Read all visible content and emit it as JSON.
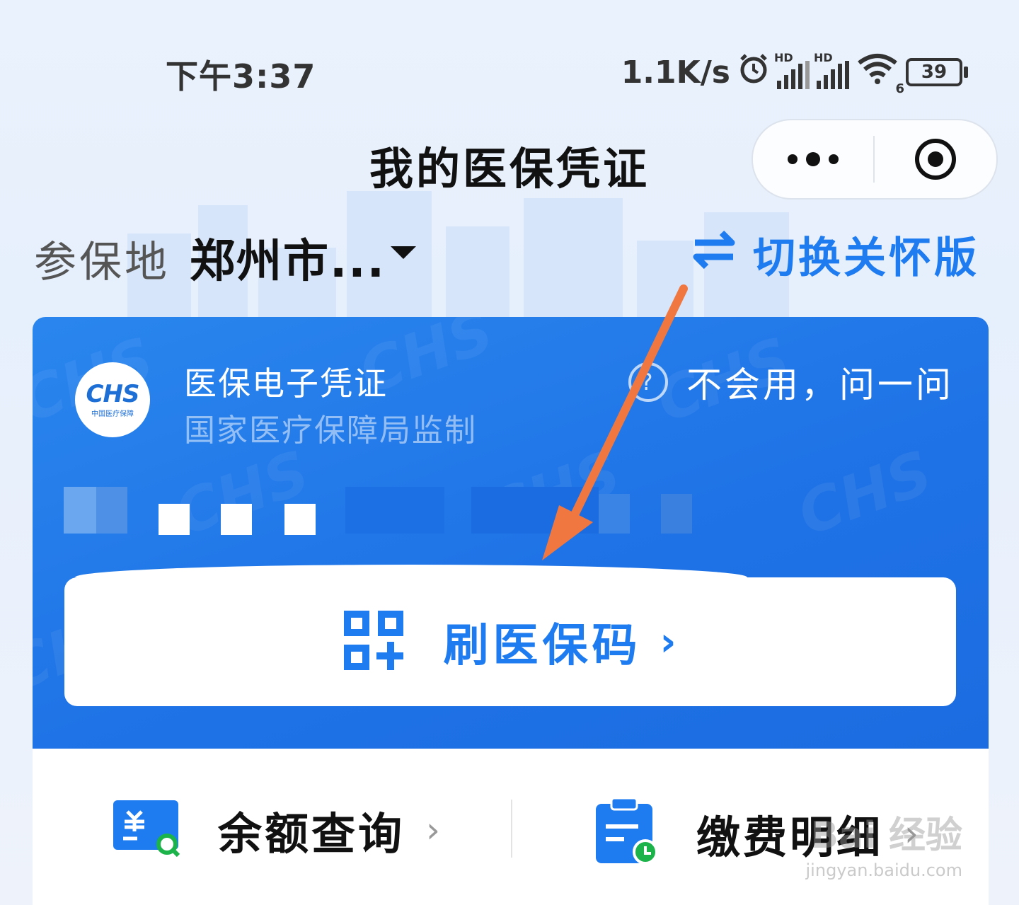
{
  "status_bar": {
    "time": "下午3:37",
    "net_speed": "1.1K/s",
    "battery": "39",
    "wifi_badge": "6",
    "hd_label": "HD"
  },
  "header": {
    "title": "我的医保凭证"
  },
  "location": {
    "label": "参保地",
    "city": "郑州市...",
    "care_mode": "切换关怀版"
  },
  "card": {
    "logo_text": "CHS",
    "logo_subtext": "中国医疗保障",
    "title": "医保电子凭证",
    "subtitle": "国家医疗保障局监制",
    "help_text": "不会用，问一问",
    "qr_button_label": "刷医保码",
    "qr_button_chevron": "›"
  },
  "actions": {
    "balance": {
      "label": "余额查询",
      "chevron": "›"
    },
    "payments": {
      "label": "缴费明细",
      "chevron": "›"
    }
  },
  "colors": {
    "accent": "#1e7bf0",
    "card_blue": "#1f73e6",
    "annotation_arrow": "#f07840",
    "green": "#1bb34a"
  },
  "watermark": {
    "brand": "Bai 经验",
    "url": "jingyan.baidu.com"
  }
}
